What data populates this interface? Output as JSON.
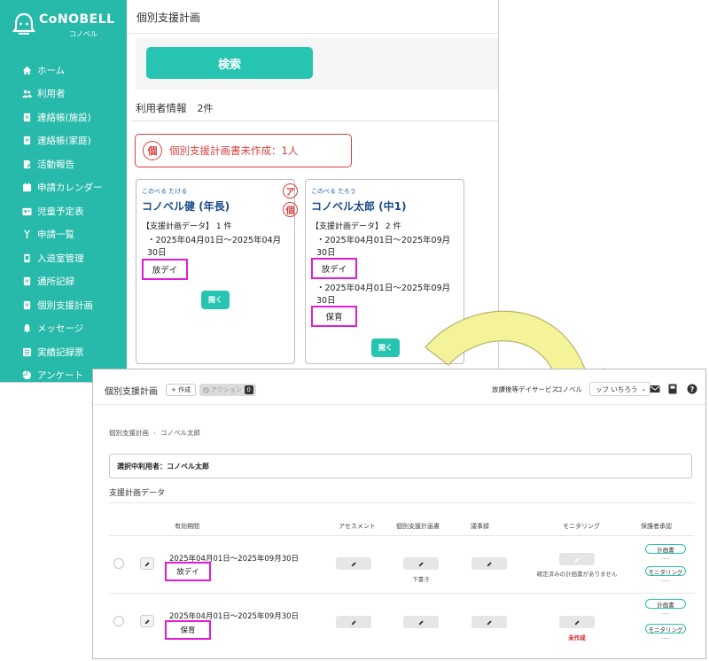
{
  "brand": {
    "name": "CoNOBELL",
    "sub": "コノベル"
  },
  "sidebar": {
    "items": [
      {
        "label": "ホーム",
        "icon": "home-icon"
      },
      {
        "label": "利用者",
        "icon": "users-icon"
      },
      {
        "label": "連絡帳(施設)",
        "icon": "notebook-icon"
      },
      {
        "label": "連絡帳(家庭)",
        "icon": "notebook-icon"
      },
      {
        "label": "活動報告",
        "icon": "report-icon"
      },
      {
        "label": "申請カレンダー",
        "icon": "calendar-icon"
      },
      {
        "label": "児童予定表",
        "icon": "schedule-icon"
      },
      {
        "label": "申請一覧",
        "icon": "list-icon"
      },
      {
        "label": "入退室管理",
        "icon": "door-icon"
      },
      {
        "label": "通所記録",
        "icon": "record-icon"
      },
      {
        "label": "個別支援計画",
        "icon": "plan-icon"
      },
      {
        "label": "メッセージ",
        "icon": "bell-icon"
      },
      {
        "label": "実績記録票",
        "icon": "table-icon"
      },
      {
        "label": "アンケート",
        "icon": "pie-icon"
      }
    ]
  },
  "back": {
    "title": "個別支援計画",
    "search_label": "検索",
    "user_info_label": "利用者情報",
    "user_info_count": "2件",
    "alert_badge": "個",
    "alert_text": "個別支援計画書未作成：1人",
    "cards": [
      {
        "kana": "このべる たける",
        "name": "コノベル健 (年長)",
        "mark1": "ア",
        "mark2": "個",
        "plan_label": "【支援計画データ】 1 件",
        "plans": [
          {
            "period_line1": "・2025年04月01日～2025年04月",
            "period_line2": "30日",
            "service": "放デイ"
          }
        ],
        "open_label": "開く"
      },
      {
        "kana": "このべる たろう",
        "name": "コノベル太郎 (中1)",
        "plan_label": "【支援計画データ】 2 件",
        "plans": [
          {
            "period_line1": "・2025年04月01日～2025年09月",
            "period_line2": "30日",
            "service": "放デイ"
          },
          {
            "period_line1": "・2025年04月01日～2025年09月",
            "period_line2": "30日",
            "service": "保育"
          }
        ],
        "open_label": "開く"
      }
    ]
  },
  "front": {
    "title": "個別支援計画",
    "create_label": "+ 作成",
    "action_label": "アクション",
    "action_count": "0",
    "org": "放課後等デイサービス",
    "office": "コノベル",
    "user": "ッフ いちろう",
    "breadcrumb": {
      "root": "個別支援計画",
      "current": "コノベル太郎"
    },
    "selected_user": "選択中利用者：コノベル太郎",
    "section_title": "支援計画データ",
    "columns": {
      "period": "有効期間",
      "assessment": "アセスメント",
      "plan_doc": "個別支援計画書",
      "minutes": "議事録",
      "monitoring": "モニタリング",
      "approval": "保護者承認"
    },
    "rows": [
      {
        "period": "2025年04月01日～2025年09月30日",
        "service": "放デイ",
        "plan_note": "下書き",
        "monitoring_note": "確定済みの計画書がありません",
        "approval": [
          {
            "label": "計画書",
            "value": "----"
          },
          {
            "label": "モニタリング",
            "value": "----"
          }
        ]
      },
      {
        "period": "2025年04月01日～2025年09月30日",
        "service": "保育",
        "monitoring_note": "未作成",
        "approval": [
          {
            "label": "計画書",
            "value": "----"
          },
          {
            "label": "モニタリング",
            "value": "----"
          }
        ]
      }
    ]
  },
  "colors": {
    "teal": "#27b9a9",
    "button": "#27c4b1",
    "alert": "#d94040",
    "highlight": "#e31bd6",
    "arrow": "#f4f39a"
  }
}
